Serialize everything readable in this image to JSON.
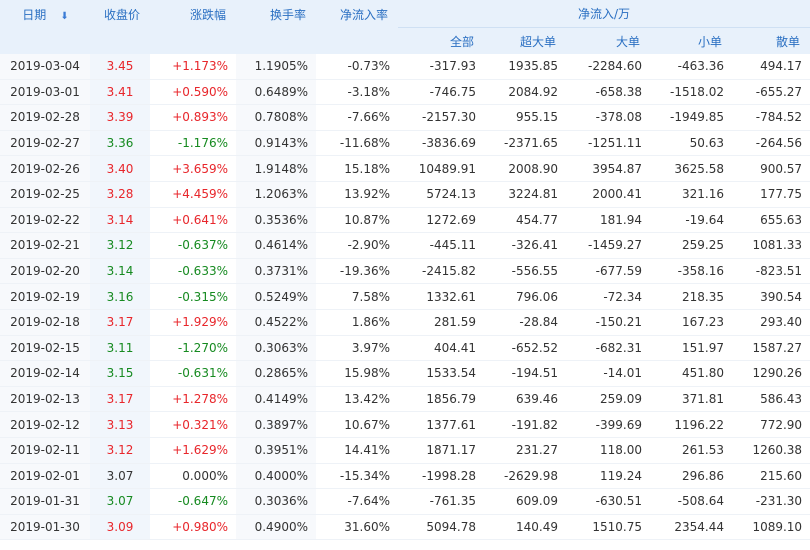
{
  "colors": {
    "up": "#e8262b",
    "down": "#168a20",
    "header_text": "#2a6fc2",
    "header_bg": "#e8f1fb"
  },
  "headers": {
    "date": "日期",
    "sort_icon": "sort-down-arrow-icon",
    "close": "收盘价",
    "change_pct": "涨跌幅",
    "turnover": "换手率",
    "net_inflow_rate": "净流入率",
    "net_inflow_group": "净流入/万",
    "all": "全部",
    "xlarge": "超大单",
    "large": "大单",
    "small": "小单",
    "retail": "散单"
  },
  "rows": [
    {
      "date": "2019-03-04",
      "close": "3.45",
      "change": "+1.173%",
      "turnover": "1.1905%",
      "rate": "-0.73%",
      "all": "-317.93",
      "xlarge": "1935.85",
      "large": "-2284.60",
      "small": "-463.36",
      "retail": "494.17",
      "trend": "up"
    },
    {
      "date": "2019-03-01",
      "close": "3.41",
      "change": "+0.590%",
      "turnover": "0.6489%",
      "rate": "-3.18%",
      "all": "-746.75",
      "xlarge": "2084.92",
      "large": "-658.38",
      "small": "-1518.02",
      "retail": "-655.27",
      "trend": "up"
    },
    {
      "date": "2019-02-28",
      "close": "3.39",
      "change": "+0.893%",
      "turnover": "0.7808%",
      "rate": "-7.66%",
      "all": "-2157.30",
      "xlarge": "955.15",
      "large": "-378.08",
      "small": "-1949.85",
      "retail": "-784.52",
      "trend": "up"
    },
    {
      "date": "2019-02-27",
      "close": "3.36",
      "change": "-1.176%",
      "turnover": "0.9143%",
      "rate": "-11.68%",
      "all": "-3836.69",
      "xlarge": "-2371.65",
      "large": "-1251.11",
      "small": "50.63",
      "retail": "-264.56",
      "trend": "down"
    },
    {
      "date": "2019-02-26",
      "close": "3.40",
      "change": "+3.659%",
      "turnover": "1.9148%",
      "rate": "15.18%",
      "all": "10489.91",
      "xlarge": "2008.90",
      "large": "3954.87",
      "small": "3625.58",
      "retail": "900.57",
      "trend": "up"
    },
    {
      "date": "2019-02-25",
      "close": "3.28",
      "change": "+4.459%",
      "turnover": "1.2063%",
      "rate": "13.92%",
      "all": "5724.13",
      "xlarge": "3224.81",
      "large": "2000.41",
      "small": "321.16",
      "retail": "177.75",
      "trend": "up"
    },
    {
      "date": "2019-02-22",
      "close": "3.14",
      "change": "+0.641%",
      "turnover": "0.3536%",
      "rate": "10.87%",
      "all": "1272.69",
      "xlarge": "454.77",
      "large": "181.94",
      "small": "-19.64",
      "retail": "655.63",
      "trend": "up"
    },
    {
      "date": "2019-02-21",
      "close": "3.12",
      "change": "-0.637%",
      "turnover": "0.4614%",
      "rate": "-2.90%",
      "all": "-445.11",
      "xlarge": "-326.41",
      "large": "-1459.27",
      "small": "259.25",
      "retail": "1081.33",
      "trend": "down"
    },
    {
      "date": "2019-02-20",
      "close": "3.14",
      "change": "-0.633%",
      "turnover": "0.3731%",
      "rate": "-19.36%",
      "all": "-2415.82",
      "xlarge": "-556.55",
      "large": "-677.59",
      "small": "-358.16",
      "retail": "-823.51",
      "trend": "down"
    },
    {
      "date": "2019-02-19",
      "close": "3.16",
      "change": "-0.315%",
      "turnover": "0.5249%",
      "rate": "7.58%",
      "all": "1332.61",
      "xlarge": "796.06",
      "large": "-72.34",
      "small": "218.35",
      "retail": "390.54",
      "trend": "down"
    },
    {
      "date": "2019-02-18",
      "close": "3.17",
      "change": "+1.929%",
      "turnover": "0.4522%",
      "rate": "1.86%",
      "all": "281.59",
      "xlarge": "-28.84",
      "large": "-150.21",
      "small": "167.23",
      "retail": "293.40",
      "trend": "up"
    },
    {
      "date": "2019-02-15",
      "close": "3.11",
      "change": "-1.270%",
      "turnover": "0.3063%",
      "rate": "3.97%",
      "all": "404.41",
      "xlarge": "-652.52",
      "large": "-682.31",
      "small": "151.97",
      "retail": "1587.27",
      "trend": "down"
    },
    {
      "date": "2019-02-14",
      "close": "3.15",
      "change": "-0.631%",
      "turnover": "0.2865%",
      "rate": "15.98%",
      "all": "1533.54",
      "xlarge": "-194.51",
      "large": "-14.01",
      "small": "451.80",
      "retail": "1290.26",
      "trend": "down"
    },
    {
      "date": "2019-02-13",
      "close": "3.17",
      "change": "+1.278%",
      "turnover": "0.4149%",
      "rate": "13.42%",
      "all": "1856.79",
      "xlarge": "639.46",
      "large": "259.09",
      "small": "371.81",
      "retail": "586.43",
      "trend": "up"
    },
    {
      "date": "2019-02-12",
      "close": "3.13",
      "change": "+0.321%",
      "turnover": "0.3897%",
      "rate": "10.67%",
      "all": "1377.61",
      "xlarge": "-191.82",
      "large": "-399.69",
      "small": "1196.22",
      "retail": "772.90",
      "trend": "up"
    },
    {
      "date": "2019-02-11",
      "close": "3.12",
      "change": "+1.629%",
      "turnover": "0.3951%",
      "rate": "14.41%",
      "all": "1871.17",
      "xlarge": "231.27",
      "large": "118.00",
      "small": "261.53",
      "retail": "1260.38",
      "trend": "up"
    },
    {
      "date": "2019-02-01",
      "close": "3.07",
      "change": "0.000%",
      "turnover": "0.4000%",
      "rate": "-15.34%",
      "all": "-1998.28",
      "xlarge": "-2629.98",
      "large": "119.24",
      "small": "296.86",
      "retail": "215.60",
      "trend": "flat"
    },
    {
      "date": "2019-01-31",
      "close": "3.07",
      "change": "-0.647%",
      "turnover": "0.3036%",
      "rate": "-7.64%",
      "all": "-761.35",
      "xlarge": "609.09",
      "large": "-630.51",
      "small": "-508.64",
      "retail": "-231.30",
      "trend": "down"
    },
    {
      "date": "2019-01-30",
      "close": "3.09",
      "change": "+0.980%",
      "turnover": "0.4900%",
      "rate": "31.60%",
      "all": "5094.78",
      "xlarge": "140.49",
      "large": "1510.75",
      "small": "2354.44",
      "retail": "1089.10",
      "trend": "up"
    }
  ]
}
